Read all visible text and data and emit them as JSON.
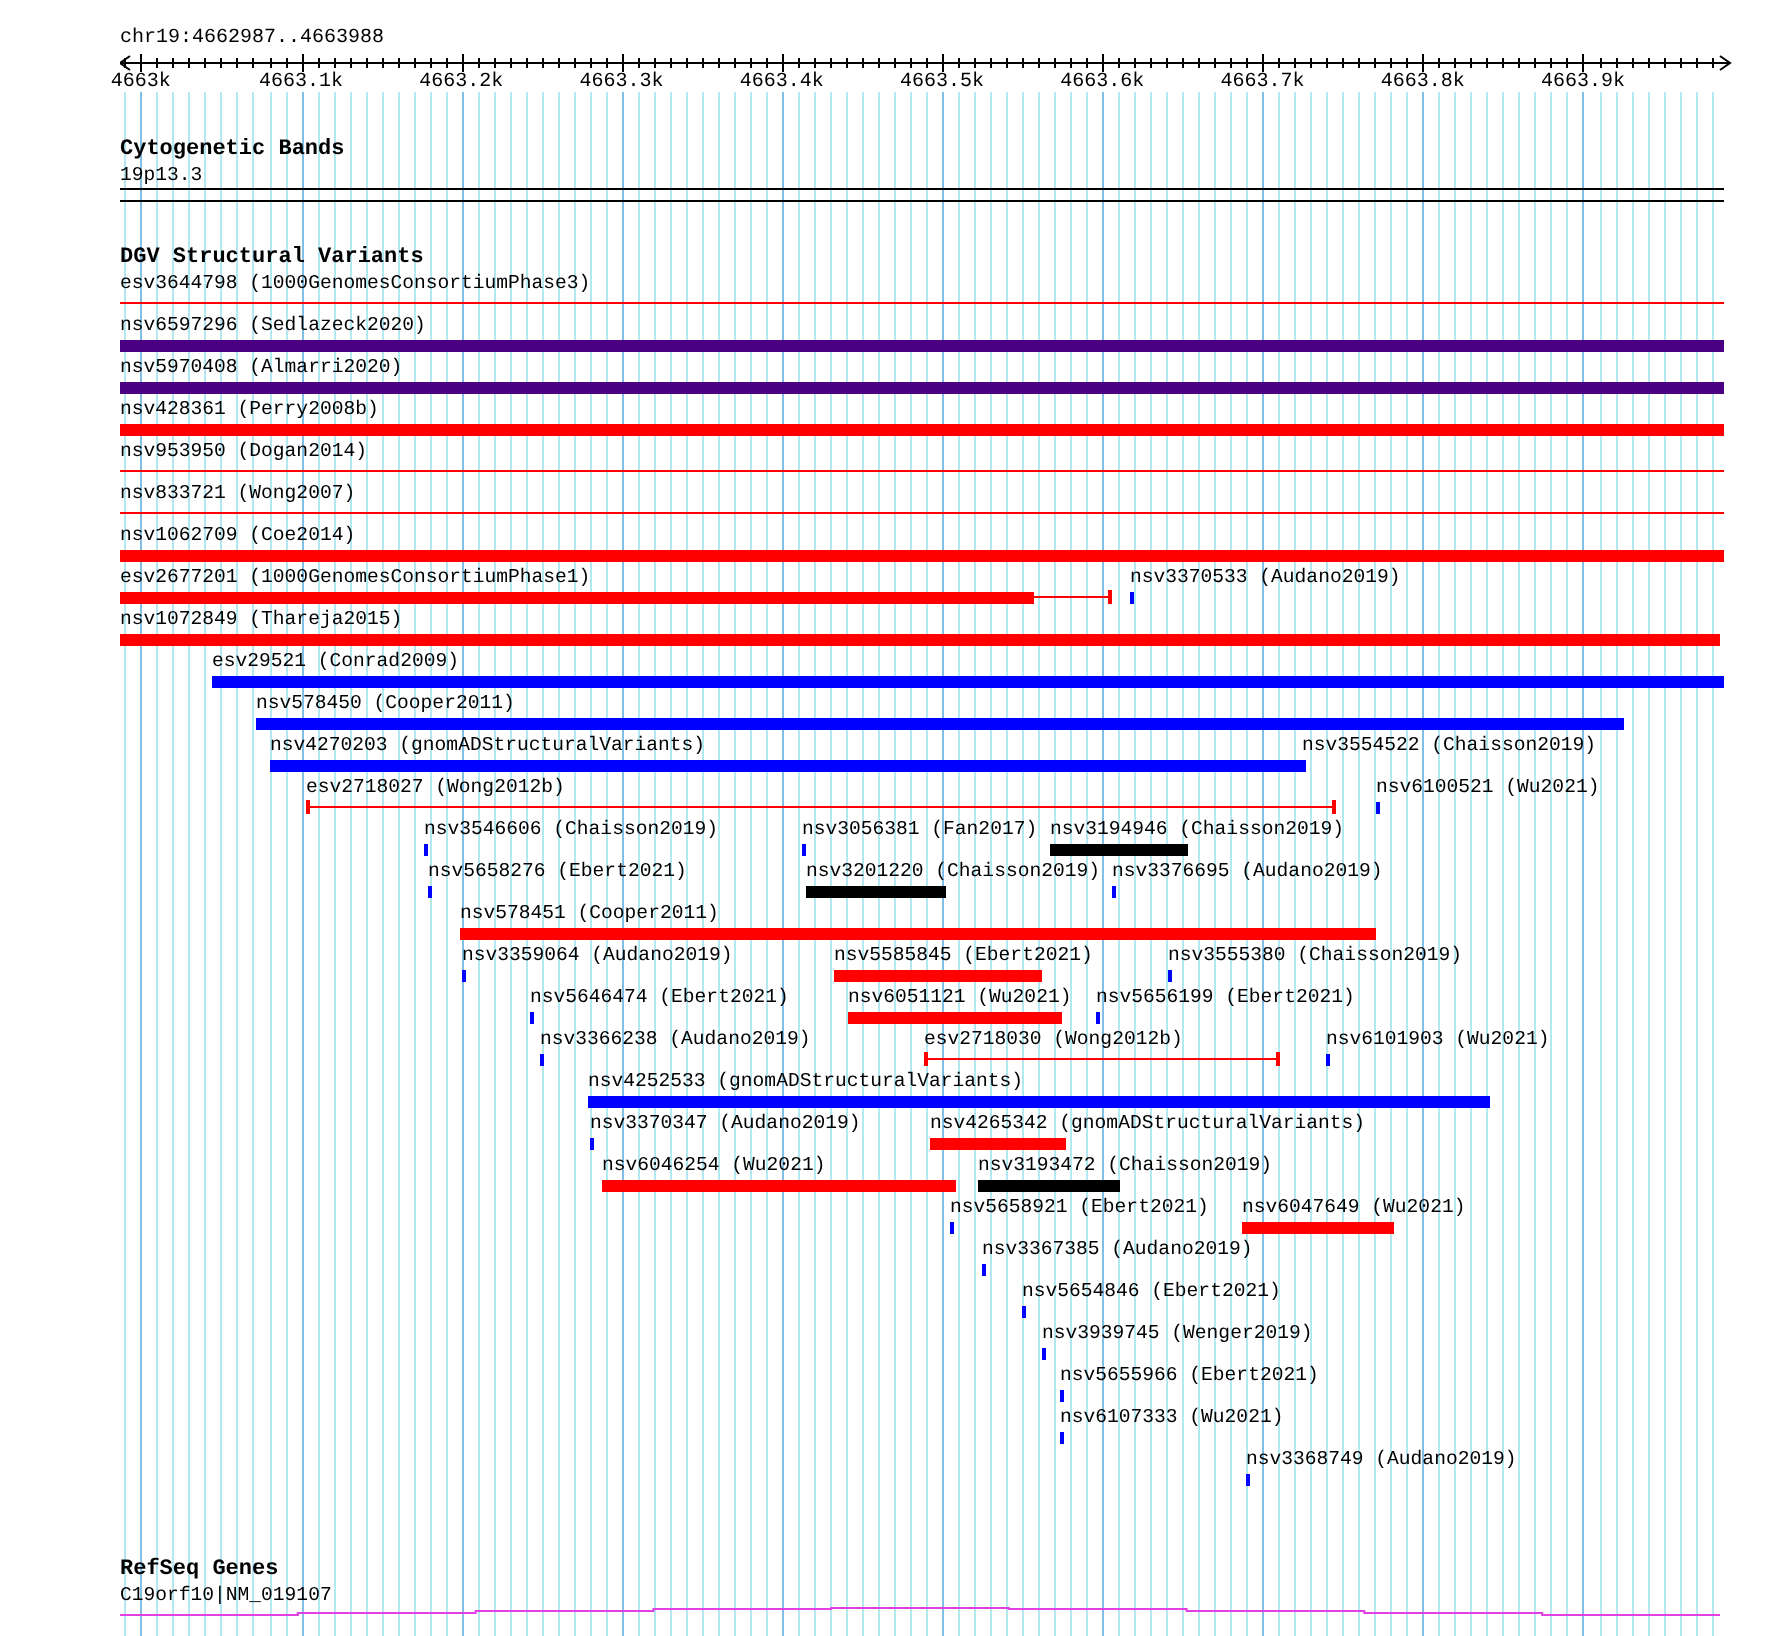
{
  "view": {
    "region": "chr19:4662987..4663988"
  },
  "ruler": {
    "ticks": [
      "4663k",
      "4663.1k",
      "4663.2k",
      "4663.3k",
      "4663.4k",
      "4663.5k",
      "4663.6k",
      "4663.7k",
      "4663.8k",
      "4663.9k"
    ]
  },
  "cytoband": {
    "title": "Cytogenetic Bands",
    "band": "19p13.3"
  },
  "dgv": {
    "title": "DGV Structural Variants",
    "rows": [
      {
        "features": [
          {
            "label": "esv3644798 (1000GenomesConsortiumPhase3)",
            "kind": "line",
            "color": "#ff0000"
          }
        ]
      },
      {
        "features": [
          {
            "label": "nsv6597296 (Sedlazeck2020)",
            "kind": "bar",
            "color": "#4b0082"
          }
        ]
      },
      {
        "features": [
          {
            "label": "nsv5970408 (Almarri2020)",
            "kind": "bar",
            "color": "#4b0082"
          }
        ]
      },
      {
        "features": [
          {
            "label": "nsv428361 (Perry2008b)",
            "kind": "bar",
            "color": "#ff0000"
          }
        ]
      },
      {
        "features": [
          {
            "label": "nsv953950 (Dogan2014)",
            "kind": "line",
            "color": "#ff0000"
          }
        ]
      },
      {
        "features": [
          {
            "label": "nsv833721 (Wong2007)",
            "kind": "line",
            "color": "#ff0000"
          }
        ]
      },
      {
        "features": [
          {
            "label": "nsv1062709 (Coe2014)",
            "kind": "bar",
            "color": "#ff0000"
          }
        ]
      },
      {
        "features": [
          {
            "label": "esv2677201 (1000GenomesConsortiumPhase1)",
            "kind": "partial",
            "color": "#ff0000"
          },
          {
            "label": "nsv3370533 (Audano2019)",
            "kind": "bar",
            "color": "#0000ff"
          }
        ]
      },
      {
        "features": [
          {
            "label": "nsv1072849 (Thareja2015)",
            "kind": "bar",
            "color": "#ff0000"
          }
        ]
      },
      {
        "features": [
          {
            "label": "esv29521 (Conrad2009)",
            "kind": "bar",
            "color": "#0000ff"
          }
        ]
      },
      {
        "features": [
          {
            "label": "nsv578450 (Cooper2011)",
            "kind": "bar",
            "color": "#0000ff"
          }
        ]
      },
      {
        "features": [
          {
            "label": "nsv4270203 (gnomADStructuralVariants)",
            "kind": "bar",
            "color": "#0000ff"
          },
          {
            "label": "nsv3554522 (Chaisson2019)",
            "kind": "bar",
            "color": "#0000ff"
          }
        ]
      },
      {
        "features": [
          {
            "label": "esv2718027 (Wong2012b)",
            "kind": "capped",
            "color": "#ff0000"
          },
          {
            "label": "nsv6100521 (Wu2021)",
            "kind": "bar",
            "color": "#0000ff"
          }
        ]
      },
      {
        "features": [
          {
            "label": "nsv3546606 (Chaisson2019)",
            "kind": "bar",
            "color": "#0000ff"
          },
          {
            "label": "nsv3056381 (Fan2017)",
            "kind": "bar",
            "color": "#0000ff"
          },
          {
            "label": "nsv3194946 (Chaisson2019)",
            "kind": "bar",
            "color": "#000000"
          }
        ]
      },
      {
        "features": [
          {
            "label": "nsv5658276 (Ebert2021)",
            "kind": "bar",
            "color": "#0000ff"
          },
          {
            "label": "nsv3201220 (Chaisson2019)",
            "kind": "bar",
            "color": "#000000"
          },
          {
            "label": "nsv3376695 (Audano2019)",
            "kind": "bar",
            "color": "#0000ff"
          }
        ]
      },
      {
        "features": [
          {
            "label": "nsv578451 (Cooper2011)",
            "kind": "bar",
            "color": "#ff0000"
          }
        ]
      },
      {
        "features": [
          {
            "label": "nsv3359064 (Audano2019)",
            "kind": "bar",
            "color": "#0000ff"
          },
          {
            "label": "nsv5585845 (Ebert2021)",
            "kind": "bar",
            "color": "#ff0000"
          },
          {
            "label": "nsv3555380 (Chaisson2019)",
            "kind": "bar",
            "color": "#0000ff"
          }
        ]
      },
      {
        "features": [
          {
            "label": "nsv5646474 (Ebert2021)",
            "kind": "bar",
            "color": "#0000ff"
          },
          {
            "label": "nsv6051121 (Wu2021)",
            "kind": "bar",
            "color": "#ff0000"
          },
          {
            "label": "nsv5656199 (Ebert2021)",
            "kind": "bar",
            "color": "#0000ff"
          }
        ]
      },
      {
        "features": [
          {
            "label": "nsv3366238 (Audano2019)",
            "kind": "bar",
            "color": "#0000ff"
          },
          {
            "label": "esv2718030 (Wong2012b)",
            "kind": "capped",
            "color": "#ff0000"
          },
          {
            "label": "nsv6101903 (Wu2021)",
            "kind": "bar",
            "color": "#0000ff"
          }
        ]
      },
      {
        "features": [
          {
            "label": "nsv4252533 (gnomADStructuralVariants)",
            "kind": "bar",
            "color": "#0000ff"
          }
        ]
      },
      {
        "features": [
          {
            "label": "nsv3370347 (Audano2019)",
            "kind": "bar",
            "color": "#0000ff"
          },
          {
            "label": "nsv4265342 (gnomADStructuralVariants)",
            "kind": "bar",
            "color": "#ff0000"
          }
        ]
      },
      {
        "features": [
          {
            "label": "nsv6046254 (Wu2021)",
            "kind": "bar",
            "color": "#ff0000"
          },
          {
            "label": "nsv3193472 (Chaisson2019)",
            "kind": "bar",
            "color": "#000000"
          }
        ]
      },
      {
        "features": [
          {
            "label": "nsv5658921 (Ebert2021)",
            "kind": "bar",
            "color": "#0000ff"
          },
          {
            "label": "nsv6047649 (Wu2021)",
            "kind": "bar",
            "color": "#ff0000"
          }
        ]
      },
      {
        "features": [
          {
            "label": "nsv3367385 (Audano2019)",
            "kind": "bar",
            "color": "#0000ff"
          }
        ]
      },
      {
        "features": [
          {
            "label": "nsv5654846 (Ebert2021)",
            "kind": "bar",
            "color": "#0000ff"
          }
        ]
      },
      {
        "features": [
          {
            "label": "nsv3939745 (Wenger2019)",
            "kind": "bar",
            "color": "#0000ff"
          }
        ]
      },
      {
        "features": [
          {
            "label": "nsv5655966 (Ebert2021)",
            "kind": "bar",
            "color": "#0000ff"
          }
        ]
      },
      {
        "features": [
          {
            "label": "nsv6107333 (Wu2021)",
            "kind": "bar",
            "color": "#0000ff"
          }
        ]
      },
      {
        "features": [
          {
            "label": "nsv3368749 (Audano2019)",
            "kind": "bar",
            "color": "#0000ff"
          }
        ]
      }
    ]
  },
  "refseq": {
    "title": "RefSeq Genes",
    "genes": [
      {
        "label": "C19orf10|NM_019107"
      }
    ]
  }
}
